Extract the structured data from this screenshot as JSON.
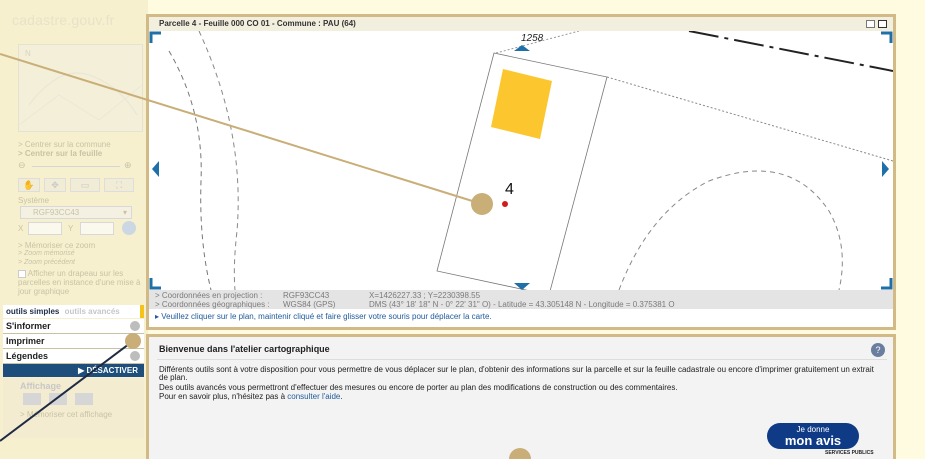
{
  "left_panel": {
    "logo": "cadastre.gouv.fr",
    "links": {
      "center_commune": "> Centrer sur la commune",
      "center_feuille": "> Centrer sur la feuille",
      "systeme_label": "Système",
      "systeme_value": "RGF93CC43",
      "x_label": "X",
      "y_label": "Y",
      "memoriser_zoom": "> Mémoriser ce zoom",
      "zoom_memorise": "> Zoom mémorisé",
      "zoom_precedent": "> Zoom précédent",
      "afficher_drapeau": "Afficher un drapeau sur les parcelles en instance d'une mise à jour graphique"
    },
    "tabs": {
      "simple": "outils simples",
      "avances": "outils avancés"
    },
    "tools": [
      {
        "label": "S'informer"
      },
      {
        "label": "Imprimer"
      },
      {
        "label": "Légendes"
      }
    ],
    "desactiver": "DÉSACTIVER",
    "affichage": {
      "title": "Affichage",
      "memoriser": "> Mémoriser cet affichage"
    }
  },
  "map": {
    "title": "Parcelle 4 - Feuille 000 CO 01 - Commune : PAU (64)",
    "parcel_number": "4",
    "other_label": "1258",
    "coords": {
      "projection_label": "> Coordonnées en projection :",
      "projection_system": "RGF93CC43",
      "projection_values": "X=1426227.33 ; Y=2230398.55",
      "geo_label": "> Coordonnées géographiques :",
      "geo_system": "WGS84 (GPS)",
      "geo_values": "DMS (43° 18' 18\" N - 0° 22' 31\" O) - Latitude = 43.305148 N - Longitude = 0.375381 O"
    },
    "hint": "▸ Veuillez cliquer sur le plan, maintenir cliqué et faire glisser votre souris pour déplacer la carte."
  },
  "welcome": {
    "title": "Bienvenue dans l'atelier cartographique",
    "p1": "Différents outils sont à votre disposition pour vous permettre de vous déplacer sur le plan, d'obtenir des informations sur la parcelle et sur la feuille cadastrale ou encore d'imprimer gratuitement un extrait de plan.",
    "p2": "Des outils avancés vous permettront d'effectuer des mesures ou encore de porter au plan des modifications de construction ou des commentaires.",
    "p3_prefix": "Pour en savoir plus, n'hésitez pas à ",
    "p3_link": "consulter l'aide",
    "p3_suffix": ".",
    "avis_line1": "Je donne",
    "avis_line2": "mon avis",
    "services": "SERVICES PUBLICS"
  },
  "colors": {
    "accent_gold": "#d1ba86",
    "building": "#fcc72e",
    "desactiver_bg": "#1d4e7c",
    "arrow_blue": "#1f6fa8"
  }
}
